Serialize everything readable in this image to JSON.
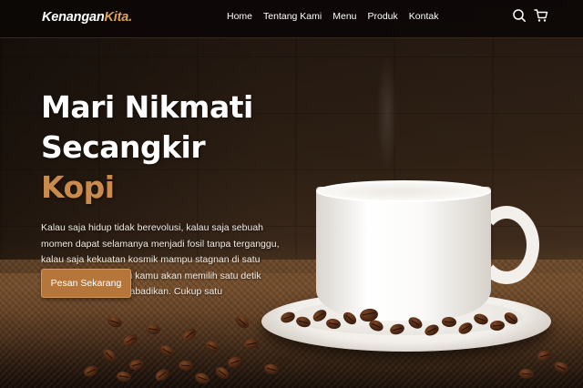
{
  "brand": {
    "name_main": "Kenangan",
    "name_accent": "Kita",
    "name_dot": ".",
    "accent_color": "#d9a25f"
  },
  "nav": {
    "links": [
      {
        "label": "Home"
      },
      {
        "label": "Tentang Kami"
      },
      {
        "label": "Menu"
      },
      {
        "label": "Produk"
      },
      {
        "label": "Kontak"
      }
    ],
    "icons": [
      "search-icon",
      "shopping-cart-icon"
    ]
  },
  "hero": {
    "title_line1": "Mari Nikmati",
    "title_line2_plain": "Secangkir ",
    "title_line2_accent": "Kopi",
    "title_accent_color": "#c98a4c",
    "description": "Kalau saja hidup tidak berevolusi, kalau saja sebuah momen dapat selamanya menjadi fosil tanpa terganggu, kalau saja kekuatan kosmik mampu stagnan di satu titik, maka tanpa ragu kamu akan memilih satu detik bersamanya untuk diabadikan. Cukup satu",
    "cta_label": "Pesan Sekarang",
    "cta_color": "#b6763a"
  }
}
